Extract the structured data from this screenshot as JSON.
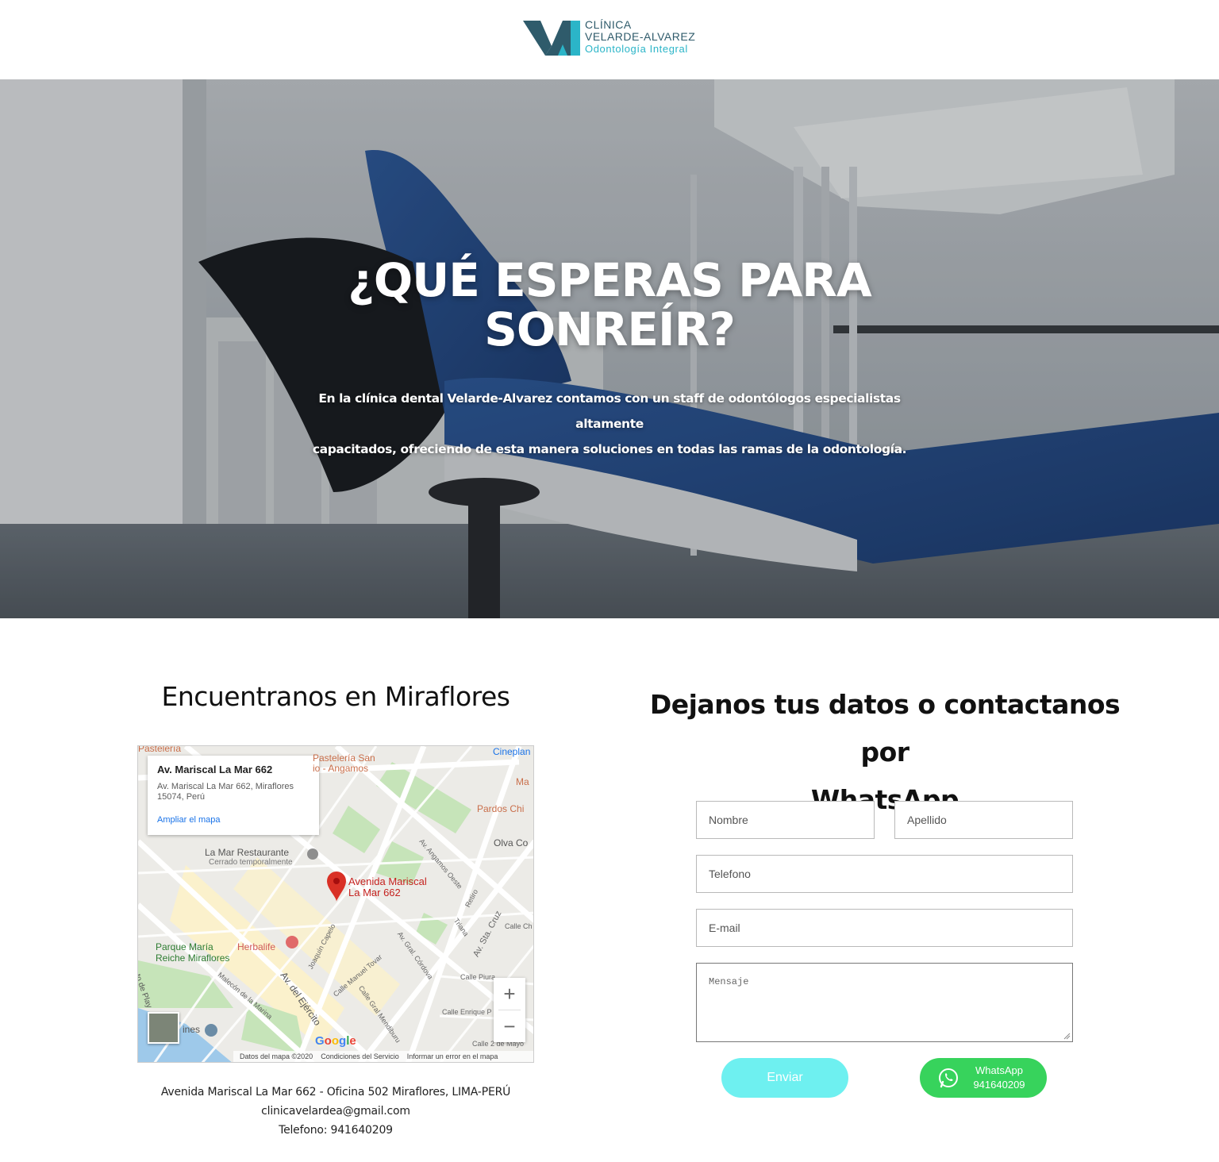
{
  "brand": {
    "line1": "CLÍNICA",
    "line2": "VELARDE-ALVAREZ",
    "line3": "Odontología Integral",
    "colors": {
      "dark": "#2f5b6b",
      "accent": "#2bb5c8"
    }
  },
  "hero": {
    "title_line1": "¿QUÉ ESPERAS PARA",
    "title_line2": "SONREÍR?",
    "subtitle_line1": "En la clínica dental Velarde-Alvarez contamos con un staff de odontólogos especialistas altamente",
    "subtitle_line2": "capacitados, ofreciendo de esta manera soluciones en todas las ramas de la odontología."
  },
  "location": {
    "title": "Encuentranos en Miraflores",
    "map": {
      "card_title": "Av. Mariscal La Mar 662",
      "card_address_line1": "Av. Mariscal La Mar 662, Miraflores",
      "card_address_line2": "15074, Perú",
      "card_link": "Ampliar el mapa",
      "pin_label_line1": "Avenida Mariscal",
      "pin_label_line2": "La Mar 662",
      "labels": {
        "pasteleria_top": "Pastelería",
        "pasteleria_san_1": "Pastelería San",
        "pasteleria_san_2": "io - Angamos",
        "cineplanet": "Cineplan",
        "ma": "Ma",
        "pardos": "Pardos Chi",
        "olva": "Olva Co",
        "restaurante": "La Mar Restaurante",
        "cerrado": "Cerrado temporalmente",
        "herbalife": "Herbalife",
        "parque_1": "Parque María",
        "parque_2": "Reiche Miraflores",
        "av_angamos": "Av. Angamos Oeste",
        "retiro": "Retiro",
        "triana": "Triana",
        "sta_cruz": "Av. Sta. Cruz",
        "calle_ch": "Calle Ch",
        "cordova": "Av. Gral. Córdova",
        "capelo": "Joaquín Capelo",
        "tovar": "Calle Manuel Tovar",
        "ejercito": "Av. del Ejército",
        "mendiburu": "Calle Gral Mendiburu",
        "malecon": "Malecón de la Marina",
        "piura": "Calle Piura",
        "enrique": "Calle Enrique P",
        "mayo": "Calle 2 de Mayo",
        "de_play": "to de Play",
        "lines": "ines",
        "google": "Google"
      },
      "zoom_in": "+",
      "zoom_out": "−",
      "footer_data": "Datos del mapa ©2020",
      "footer_terms": "Condiciones del Servicio",
      "footer_report": "Informar un error en el mapa"
    },
    "address": "Avenida Mariscal La Mar 662 - Oficina 502 Miraflores, LIMA-PERÚ",
    "email": "clinicavelardea@gmail.com",
    "phone": "Telefono: 941640209"
  },
  "contact": {
    "title_line1": "Dejanos tus datos o contactanos por",
    "title_line2": "WhatsApp",
    "fields": {
      "nombre": "Nombre",
      "apellido": "Apellido",
      "telefono": "Telefono",
      "email": "E-mail",
      "mensaje": "Mensaje"
    },
    "send_label": "Enviar",
    "whatsapp_label": "WhatsApp",
    "whatsapp_number": "941640209",
    "colors": {
      "send": "#6ef0f0",
      "whatsapp": "#37d35c"
    }
  }
}
